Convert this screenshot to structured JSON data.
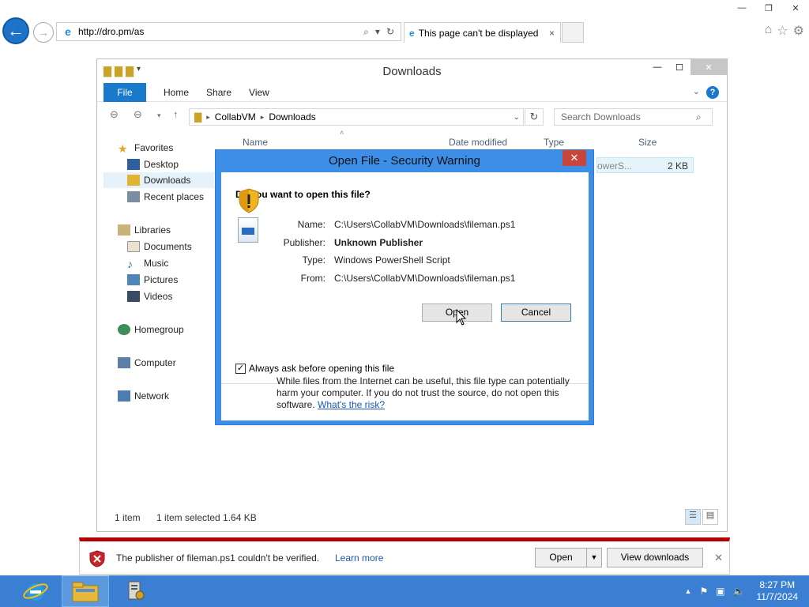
{
  "browser": {
    "url": "http://dro.pm/as",
    "tab_title": "This page can't be displayed",
    "tab_close": "×"
  },
  "explorer": {
    "title": "Downloads",
    "ribbon": {
      "file": "File",
      "home": "Home",
      "share": "Share",
      "view": "View"
    },
    "breadcrumb": [
      "CollabVM",
      "Downloads"
    ],
    "search_placeholder": "Search Downloads",
    "columns": {
      "name": "Name",
      "date": "Date modified",
      "type": "Type",
      "size": "Size"
    },
    "file_row": {
      "name_partial": "owerS...",
      "size": "2 KB"
    },
    "nav": {
      "favorites": "Favorites",
      "desktop": "Desktop",
      "downloads": "Downloads",
      "recent": "Recent places",
      "libraries": "Libraries",
      "documents": "Documents",
      "music": "Music",
      "pictures": "Pictures",
      "videos": "Videos",
      "homegroup": "Homegroup",
      "computer": "Computer",
      "network": "Network"
    },
    "status": {
      "count": "1 item",
      "selected": "1 item selected  1.64 KB"
    }
  },
  "dialog": {
    "title": "Open File - Security Warning",
    "question": "Do you want to open this file?",
    "labels": {
      "name": "Name:",
      "publisher": "Publisher:",
      "type": "Type:",
      "from": "From:"
    },
    "values": {
      "name": "C:\\Users\\CollabVM\\Downloads\\fileman.ps1",
      "publisher": "Unknown Publisher",
      "type": "Windows PowerShell Script",
      "from": "C:\\Users\\CollabVM\\Downloads\\fileman.ps1"
    },
    "open_label": "Open",
    "cancel_label": "Cancel",
    "checkbox_label": "Always ask before opening this file",
    "checkbox_checked": true,
    "warning_text": "While files from the Internet can be useful, this file type can potentially harm your computer. If you do not trust the source, do not open this software.",
    "risk_link": "What's the risk?"
  },
  "notification": {
    "message": "The publisher of fileman.ps1 couldn't be verified.",
    "learn_more": "Learn more",
    "open_label": "Open",
    "view_downloads": "View downloads"
  },
  "taskbar": {
    "time": "8:27 PM",
    "date": "11/7/2024"
  },
  "colors": {
    "accent": "#1979ca",
    "dialog_frame": "#3c8ee7",
    "taskbar": "#3a7fd2",
    "notif_border": "#b80000"
  }
}
